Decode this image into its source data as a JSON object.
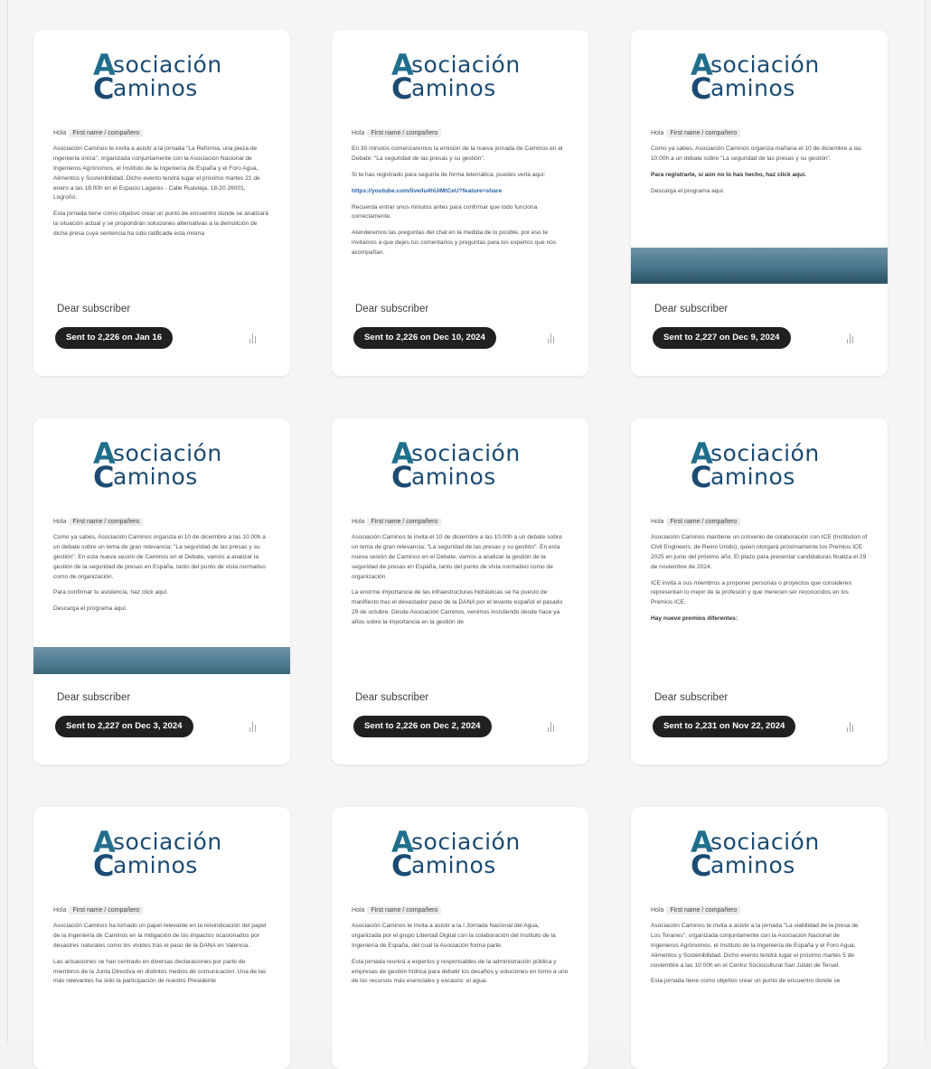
{
  "brand": {
    "logo_line1": "sociación",
    "logo_line2": "aminos",
    "logo_initial_a": "A",
    "logo_initial_c": "C",
    "colors": {
      "primary": "#1b4b73",
      "accent": "#1f6f8c",
      "pill": "#221f1f",
      "link": "#2b63a8"
    }
  },
  "common": {
    "greeting_prefix": "Hola",
    "merge_tag": "First name / compañero",
    "recipient_label": "Dear subscriber",
    "stats_icon": "bar-chart-icon"
  },
  "campaigns": [
    {
      "status": "Sent to 2,226 on Jan 16",
      "paragraphs": [
        "Asociación Caminos te invita a asistir a la jornada \"La Reforma, una pieza de ingeniería única\", organizada conjuntamente con la Asociación Nacional de Ingenieros Agrónomos, el Instituto de la Ingeniería de España y el Foro Agua, Alimentos y Sostenibilidad. Dicho evento tendrá lugar el próximo martes 21 de enero a las 18:00h en el Espacio Lagares - Calle Ruavieja, 18-20 26001, Logroño.",
        "Esta jornada tiene como objetivo crear un punto de encuentro donde se analizará la situación actual y se propondrán soluciones alternativas a la demolición de dicha presa cuya sentencia ha sido ratificada esta misma"
      ]
    },
    {
      "status": "Sent to 2,226 on Dec 10, 2024",
      "paragraphs": [
        "En 30 minutos comenzaremos la emisión de la nueva jornada de Caminos en el Debate: \"La seguridad de las presas y su gestión\".",
        "Si te has registrado para seguirla de forma telemática, puedes verla aquí:",
        "https://youtube.com/live/lu4hUiMtCeU?feature=share",
        "Recuerda entrar unos minutos antes para confirmar que todo funciona correctamente.",
        "Atenderemos las preguntas del chat en la medida de lo posible, por eso te invitamos a que dejes tus comentarios y preguntas para los expertos que nos acompañan."
      ]
    },
    {
      "status": "Sent to 2,227 on Dec 9, 2024",
      "paragraphs": [
        "Como ya sabes, Asociación Caminos organiza mañana el 10 de diciembre a las 10.00h a un debate sobre \"La seguridad de las presas y su gestión\".",
        "Para registrarte, si aún no lo has hecho, haz click aquí.",
        "Descarga el programa aquí."
      ]
    },
    {
      "status": "Sent to 2,227 on Dec 3, 2024",
      "paragraphs": [
        "Como ya sabes, Asociación Caminos organiza el 10 de diciembre a las 10.00h a un debate sobre un tema de gran relevancia: \"La seguridad de las presas y su gestión\". En esta nueva sesión de Caminos en el Debate, vamos a analizar la gestión de la seguridad de presas en España, tanto del punto de vista normativo como de organización.",
        "Para confirmar tu asistencia, haz click aquí.",
        "Descarga el programa aquí."
      ]
    },
    {
      "status": "Sent to 2,226 on Dec 2, 2024",
      "paragraphs": [
        "Asociación Caminos te invita el 10 de diciembre a las 10.00h a un debate sobre un tema de gran relevancia: \"La seguridad de las presas y su gestión\". En esta nueva sesión de Caminos en el Debate, vamos a analizar la gestión de la seguridad de presas en España, tanto del punto de vista normativo como de organización.",
        "La enorme importancia de las infraestructuras hidráulicas se ha puesto de manifiesto tras el devastador paso de la DANA por el levante español el pasado 29 de octubre. Desde Asociación Caminos, venimos insistiendo desde hace ya años sobre la importancia en la gestión de"
      ]
    },
    {
      "status": "Sent to 2,231 on Nov 22, 2024",
      "paragraphs": [
        "Asociación Caminos mantiene un convenio de colaboración con ICE (Institution of Civil Engineers, de Reino Unido), quien otorgará próximamente los Premios ICE 2025 en junio del próximo año. El plazo para presentar candidaturas finaliza el 29 de noviembre de 2024.",
        "ICE invita a sus miembros a proponer personas o proyectos que consideren representan lo mejor de la profesión y que merecen ser reconocidos en los Premios ICE.",
        "Hay nueve premios diferentes:"
      ]
    },
    {
      "status": "",
      "paragraphs": [
        "Asociación Caminos ha tomado un papel relevante en la reivindicación del papel de la Ingeniería de Caminos en la mitigación de los impactos ocasionados por desastres naturales como los vividos tras el paso de la DANA en Valencia.",
        "Las actuaciones se han centrado en diversas declaraciones por parte de miembros de la Junta Directiva en distintos medios de comunicación. Una de las más relevantes ha sido la participación de nuestro Presidente"
      ]
    },
    {
      "status": "",
      "paragraphs": [
        "Asociación Caminos te invita a asistir a la I Jornada Nacional del Agua, organizada por el grupo Libertad Digital con la colaboración del Instituto de la Ingeniería de España, del cual la Asociación forma parte.",
        "Esta jornada reunirá a expertos y responsables de la administración pública y empresas de gestión hídrica para debatir los desafíos y soluciones en torno a uno de los recursos más esenciales y escasos: el agua."
      ]
    },
    {
      "status": "",
      "paragraphs": [
        "Asociación Caminos te invita a asistir a la jornada \"La viabilidad de la presa de Los Toranes\", organizada conjuntamente con la Asociación Nacional de Ingenieros Agrónomos, el Instituto de la Ingeniería de España y el Foro Agua, Alimentos y Sostenibilidad. Dicho evento tendrá lugar el próximo martes 5 de noviembre a las 10:00h en el Centro Sociocultural San Julián de Teruel.",
        "Esta jornada tiene como objetivo crear un punto de encuentro donde se"
      ]
    }
  ]
}
